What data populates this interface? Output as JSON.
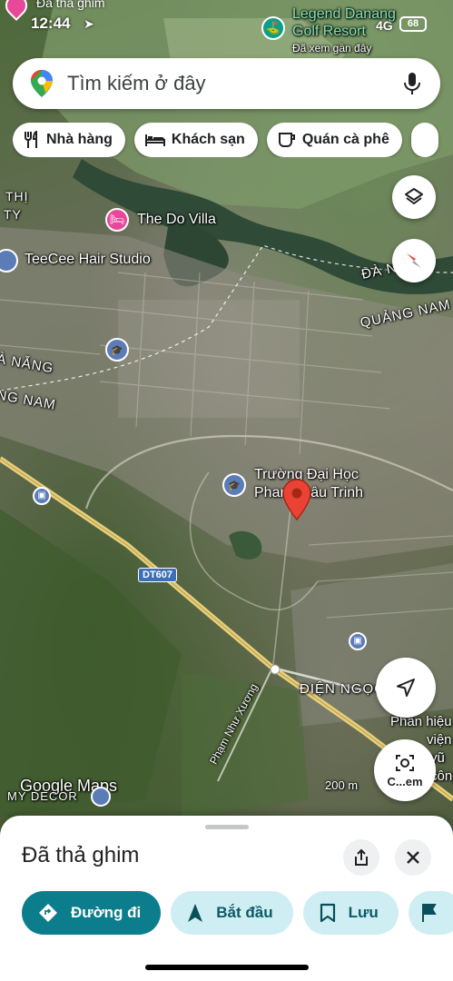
{
  "status_bar": {
    "time": "12:44",
    "back_label": "Đã thả ghim",
    "network": "4G",
    "battery": "68"
  },
  "search": {
    "placeholder": "Tìm kiếm ở đây"
  },
  "chips": [
    {
      "label": "Nhà hàng",
      "icon": "fork-knife-icon"
    },
    {
      "label": "Khách sạn",
      "icon": "bed-icon"
    },
    {
      "label": "Quán cà phê",
      "icon": "coffee-cup-icon"
    }
  ],
  "map": {
    "places": {
      "legend_danang": {
        "line1": "Legend Danang",
        "line2": "Golf Resort",
        "sub": "Đã xem gần đây"
      },
      "do_villa": "The Do Villa",
      "teecee": "TeeCee Hair Studio",
      "university": {
        "line1": "Trường Đại Học",
        "line2": "Phan Châu Trinh"
      },
      "area_thi": "THỊ",
      "area_ty": "TY",
      "da_nang_right": "ĐÀ N",
      "quang_nam_right": "QUẢNG NAM",
      "da_nang_left": "À NẴNG",
      "quang_nam_left": "NG NAM",
      "dien_ngoc": "ĐIỆN NGỌC",
      "phan_hieu": {
        "line1": "Phân hiệu",
        "line2": "viện",
        "line3": "vũ",
        "line4": "công"
      },
      "my_decor": "MY DECOR",
      "road_name": "Phạm Như Xương",
      "route_shield": "DT607",
      "google_maps": "Google Maps",
      "scale": "200 m",
      "lens_label": "C...em"
    }
  },
  "sheet": {
    "title": "Đã thả ghim",
    "actions": [
      {
        "label": "Đường đi",
        "icon": "directions-icon"
      },
      {
        "label": "Bắt đầu",
        "icon": "navigation-arrow-icon"
      },
      {
        "label": "Lưu",
        "icon": "bookmark-icon"
      }
    ]
  },
  "colors": {
    "accent": "#0b7d8c",
    "tonal": "#cfeef4",
    "pin_red": "#ea4335",
    "poi_pink": "#e8489a",
    "poi_teal": "#0f9d8a",
    "poi_blue": "#5c7cb8"
  }
}
